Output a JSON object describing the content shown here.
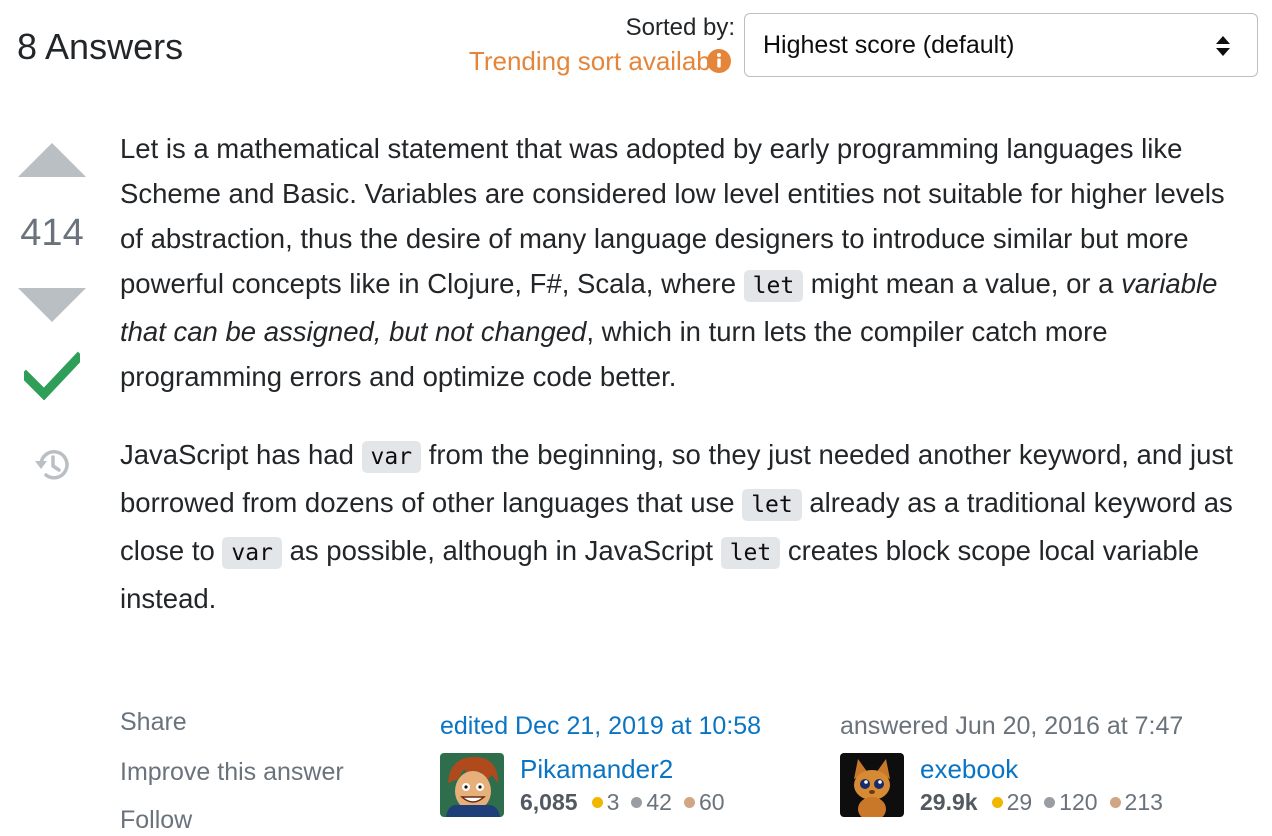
{
  "header": {
    "answers_count": "8 Answers",
    "sorted_by_label": "Sorted by:",
    "trending_label": "Trending sort available",
    "sort_select": {
      "selected": "Highest score (default)"
    }
  },
  "vote": {
    "score": "414",
    "accepted": true
  },
  "answer": {
    "p1": {
      "t1": "Let is a mathematical statement that was adopted by early programming languages like Scheme and Basic. Variables are considered low level entities not suitable for higher levels of abstraction, thus the desire of many language designers to introduce similar but more powerful concepts like in Clojure, F#, Scala, where ",
      "c1": "let",
      "t2": " might mean a value, or a ",
      "em1": "variable that can be assigned, but not changed",
      "t3": ", which in turn lets the compiler catch more programming errors and optimize code better."
    },
    "p2": {
      "t1": "JavaScript has had ",
      "c1": "var",
      "t2": " from the beginning, so they just needed another keyword, and just borrowed from dozens of other languages that use ",
      "c2": "let",
      "t3": " already as a traditional keyword as close to ",
      "c3": "var",
      "t4": " as possible, although in JavaScript ",
      "c4": "let",
      "t5": " creates block scope local variable instead."
    }
  },
  "post_menu": {
    "share": "Share",
    "improve": "Improve this answer",
    "follow": "Follow"
  },
  "editor": {
    "action": "edited Dec 21, 2019 at 10:58",
    "name": "Pikamander2",
    "rep": "6,085",
    "gold": "3",
    "silver": "42",
    "bronze": "60"
  },
  "owner": {
    "action": "answered Jun 20, 2016 at 7:47",
    "name": "exebook",
    "rep": "29.9k",
    "gold": "29",
    "silver": "120",
    "bronze": "213"
  },
  "colors": {
    "link": "#0a74c4",
    "trending": "#e4853a",
    "accepted": "#2f9e59",
    "vote_arrow": "#babfc4",
    "gold_badge": "#f1b600",
    "silver_badge": "#9a9ea4",
    "bronze_badge": "#d1a684"
  },
  "icons": {
    "info": "info-circle-icon",
    "sort_arrows": "sort-arrows-icon",
    "upvote": "upvote-arrow-icon",
    "downvote": "downvote-arrow-icon",
    "accepted": "checkmark-icon",
    "history": "history-icon"
  }
}
